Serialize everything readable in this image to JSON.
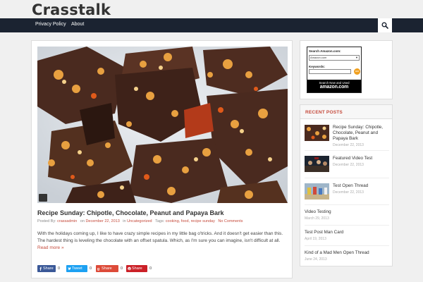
{
  "site": {
    "title": "Crasstalk"
  },
  "nav": {
    "items": [
      "Privacy Policy",
      "About"
    ],
    "search_icon": "search-icon"
  },
  "post": {
    "title": "Recipe Sunday: Chipotle, Chocolate, Peanut and Papaya Bark",
    "meta": {
      "posted_by_label": "Posted By:",
      "author": "crassadmin",
      "on_label": "on",
      "date": "December 22, 2013",
      "in_label": "in",
      "category": "Uncategorized",
      "tags_label": "Tags:",
      "tags": "cooking, food, recipe sunday",
      "comments": "No Comments"
    },
    "excerpt": "With the holidays coming up, I like to have crazy simple recipes in my little bag o'tricks. And it doesn't get easier than this. The hardest thing is leveling the chocolate with an offset spatula. Which, as I'm sure you can imagine, isn't difficult at all.",
    "read_more": "Read more »"
  },
  "share": {
    "facebook": {
      "label": "Share",
      "count": "0"
    },
    "twitter": {
      "label": "Tweet",
      "count": "0"
    },
    "google": {
      "label": "Share",
      "count": "0"
    },
    "pinterest": {
      "label": "Share",
      "count": "0"
    }
  },
  "amazon": {
    "search_label": "Search Amazon.com:",
    "select_value": "Amazon.com",
    "keywords_label": "Keywords:",
    "go_label": "GO",
    "banner_line1": "Search New and Used",
    "banner_line2": "amazon.com"
  },
  "recent": {
    "heading": "RECENT POSTS",
    "items": [
      {
        "title": "Recipe Sunday: Chipotle, Chocolate, Peanut and Papaya Bark",
        "date": "December 22, 2013"
      },
      {
        "title": "Featured Video Test",
        "date": "December 22, 2013"
      },
      {
        "title": "Test Open Thread",
        "date": "December 22, 2013"
      },
      {
        "title": "Video Testing",
        "date": "March 29, 2013"
      },
      {
        "title": "Test Post Man Card",
        "date": "April 19, 2013"
      },
      {
        "title": "Kind of a Mad Men Open Thread",
        "date": "June 24, 2013"
      }
    ]
  },
  "colors": {
    "navbar": "#1b2331",
    "accent": "#c54b3c",
    "facebook": "#3b5998",
    "twitter": "#1da1f2",
    "google": "#dd4b39",
    "pinterest": "#cb2027"
  }
}
